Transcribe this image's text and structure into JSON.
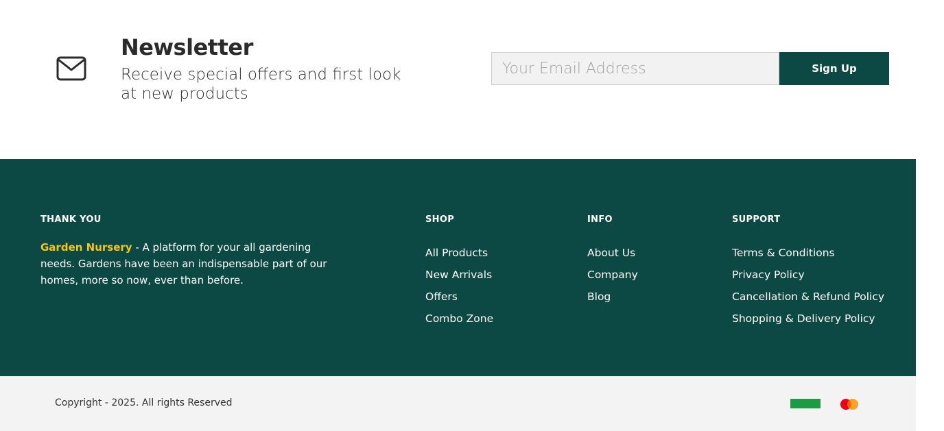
{
  "newsletter": {
    "title": "Newsletter",
    "subtitle": "Receive special offers and first look at new products",
    "email_placeholder": "Your Email Address",
    "signup_label": "Sign Up",
    "icon": "mail-icon"
  },
  "footer": {
    "about": {
      "heading": "THANK YOU",
      "brand": "Garden Nursery",
      "text": " - A platform for your all gardening needs. Gardens have been an indispensable part of our homes, more so now, ever than before."
    },
    "shop": {
      "heading": "SHOP",
      "links": [
        "All Products",
        "New Arrivals",
        "Offers",
        "Combo Zone"
      ]
    },
    "info": {
      "heading": "INFO",
      "links": [
        "About Us",
        "Company",
        "Blog"
      ]
    },
    "support": {
      "heading": "SUPPORT",
      "links": [
        "Terms & Conditions",
        "Privacy Policy",
        "Cancellation & Refund Policy",
        "Shopping & Delivery Policy"
      ]
    }
  },
  "bottom": {
    "copyright": "Copyright - 2025. All rights Reserved",
    "payment_icons": [
      "green-payment-badge-icon",
      "mastercard-icon"
    ]
  },
  "colors": {
    "primary": "#0d4944",
    "brand_accent": "#f5c518",
    "input_bg": "#f2f2f2",
    "bottom_bg": "#f3f3f3"
  }
}
